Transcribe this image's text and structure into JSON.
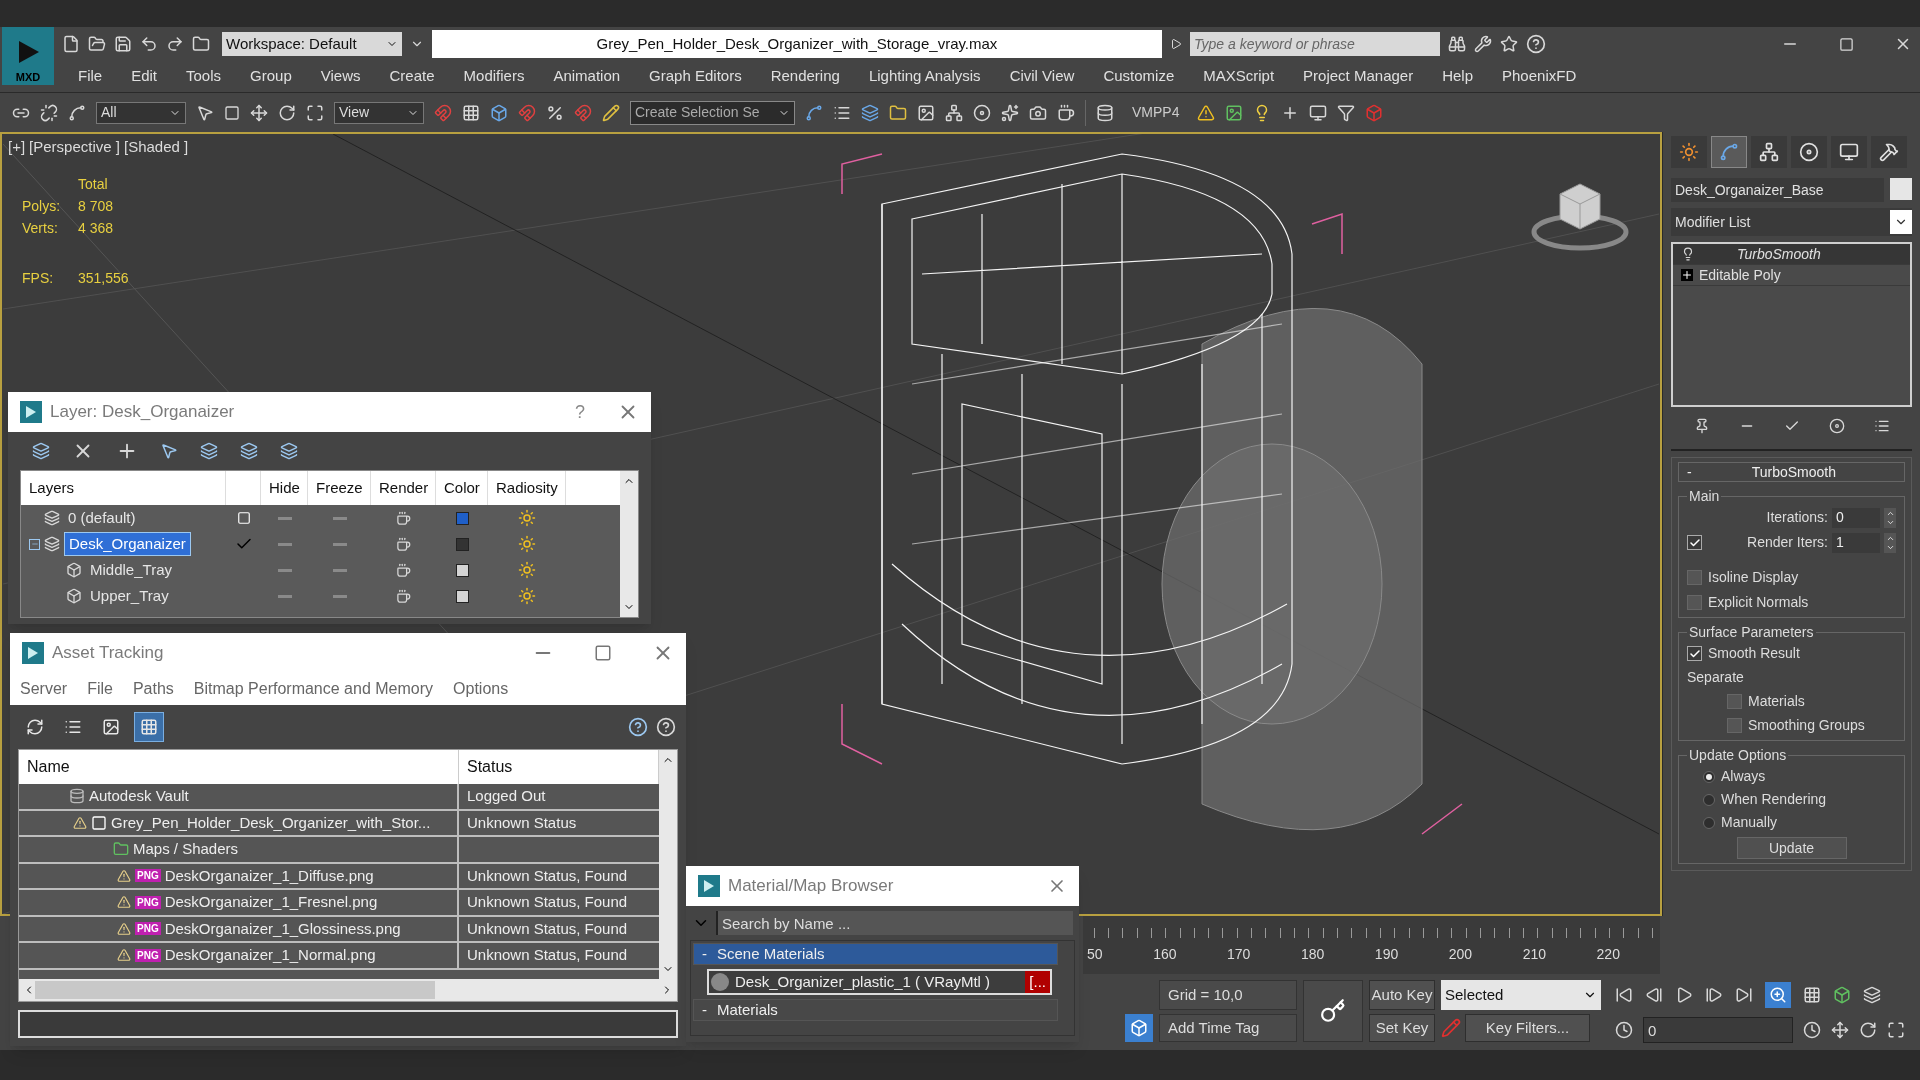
{
  "app_badge": "MXD",
  "title_bar": {
    "workspace": "Workspace: Default",
    "title": "Grey_Pen_Holder_Desk_Organizer_with_Storage_vray.max",
    "search": {
      "placeholder": "Type a keyword or phrase"
    }
  },
  "menu": [
    "File",
    "Edit",
    "Tools",
    "Group",
    "Views",
    "Create",
    "Modifiers",
    "Animation",
    "Graph Editors",
    "Rendering",
    "Lighting Analysis",
    "Civil View",
    "Customize",
    "MAXScript",
    "Project Manager",
    "Help",
    "PhoenixFD"
  ],
  "toolbar": {
    "selection_filter": "All",
    "reference_coordinate": "View",
    "named_selection": {
      "placeholder": "Create Selection Se"
    },
    "plugin": "VMPP4"
  },
  "viewport": {
    "labels": [
      "[+]",
      "[Perspective ]",
      "[Shaded ]"
    ],
    "stats_header": "Total",
    "stats": [
      {
        "label": "Polys:",
        "value": "8 708"
      },
      {
        "label": "Verts:",
        "value": "4 368"
      }
    ],
    "fps": {
      "label": "FPS:",
      "value": "351,556"
    }
  },
  "layer_dialog": {
    "title": "Layer: Desk_Organaizer",
    "help": "?",
    "columns": [
      "Layers",
      "Hide",
      "Freeze",
      "Render",
      "Color",
      "Radiosity"
    ],
    "rows": [
      {
        "kind": "layer",
        "name": "0 (default)",
        "current": false,
        "selected": false,
        "color": "#1f5fc8"
      },
      {
        "kind": "layer",
        "name": "Desk_Organaizer",
        "current": true,
        "selected": true,
        "expanded": true,
        "color": "#333333",
        "children": [
          {
            "kind": "object",
            "name": "Middle_Tray",
            "selected": false,
            "color": "#d4d4d4"
          },
          {
            "kind": "object",
            "name": "Upper_Tray",
            "selected": false,
            "color": "#d4d4d4"
          }
        ]
      }
    ]
  },
  "asset_tracking": {
    "title": "Asset Tracking",
    "menu": [
      "Server",
      "File",
      "Paths",
      "Bitmap Performance and Memory",
      "Options"
    ],
    "views": [
      {
        "selected": false
      },
      {
        "selected": false
      },
      {
        "selected": false
      },
      {
        "selected": true
      }
    ],
    "columns": [
      "Name",
      "Status"
    ],
    "rows": [
      {
        "kind": "vault",
        "warning": false,
        "name": "Autodesk Vault",
        "status": "Logged Out",
        "children": [
          {
            "kind": "scene",
            "warning": true,
            "name": "Grey_Pen_Holder_Desk_Organizer_with_Stor...",
            "status": "Unknown Status",
            "children": [
              {
                "kind": "folder",
                "warning": false,
                "name": "Maps / Shaders",
                "children": [
                  {
                    "kind": "bitmap",
                    "warning": true,
                    "badge": "PNG",
                    "name": "DeskOrganaizer_1_Diffuse.png",
                    "status": "Unknown Status, Found"
                  },
                  {
                    "kind": "bitmap",
                    "warning": true,
                    "badge": "PNG",
                    "name": "DeskOrganaizer_1_Fresnel.png",
                    "status": "Unknown Status, Found"
                  },
                  {
                    "kind": "bitmap",
                    "warning": true,
                    "badge": "PNG",
                    "name": "DeskOrganaizer_1_Glossiness.png",
                    "status": "Unknown Status, Found"
                  },
                  {
                    "kind": "bitmap",
                    "warning": true,
                    "badge": "PNG",
                    "name": "DeskOrganaizer_1_Normal.png",
                    "status": "Unknown Status, Found"
                  }
                ]
              }
            ]
          }
        ]
      }
    ]
  },
  "material_browser": {
    "title": "Material/Map Browser",
    "search": {
      "placeholder": "Search by Name ..."
    },
    "groups": [
      {
        "toggle": "-",
        "label": "Scene Materials",
        "selected": true,
        "items": [
          {
            "label": "Desk_Organizer_plastic_1 ( VRayMtl )",
            "tag": "[..."
          }
        ]
      },
      {
        "toggle": "-",
        "label": "Materials",
        "selected": false
      }
    ]
  },
  "command_panel": {
    "tabs": [
      {
        "selected": false
      },
      {
        "selected": true
      },
      {
        "selected": false
      },
      {
        "selected": false
      },
      {
        "selected": false
      },
      {
        "selected": false
      }
    ],
    "object_name": "Desk_Organaizer_Base",
    "modifier_list": "Modifier List",
    "stack": [
      {
        "kind": "modifier",
        "label": "TurboSmooth",
        "selected": true
      },
      {
        "kind": "base",
        "label": "Editable Poly",
        "selected": false
      }
    ],
    "rollout": {
      "toggle": "-",
      "title": "TurboSmooth",
      "main": {
        "title": "Main",
        "spinners": [
          {
            "kind": "spinner",
            "label": "Iterations:",
            "value": "0"
          },
          {
            "kind": "check_spinner",
            "label": "Render Iters:",
            "value": "1",
            "checked": true
          }
        ],
        "checks": [
          {
            "label": "Isoline Display",
            "checked": false
          },
          {
            "label": "Explicit Normals",
            "checked": false
          }
        ]
      },
      "surface": {
        "title": "Surface Parameters",
        "smooth": {
          "label": "Smooth Result",
          "checked": true
        },
        "separate": "Separate",
        "checks": [
          {
            "label": "Materials",
            "checked": false
          },
          {
            "label": "Smoothing Groups",
            "checked": false
          }
        ]
      },
      "update": {
        "title": "Update Options",
        "radios": [
          {
            "label": "Always",
            "selected": true
          },
          {
            "label": "When Rendering",
            "selected": false
          },
          {
            "label": "Manually",
            "selected": false
          }
        ],
        "button": "Update"
      }
    }
  },
  "timeline": {
    "ticks": [
      "50",
      "160",
      "170",
      "180",
      "190",
      "200",
      "210",
      "220"
    ]
  },
  "controls": {
    "time_tag": "Add Time Tag",
    "grid": "Grid = 10,0",
    "auto_key": "Auto Key",
    "set_key": "Set Key",
    "key_mode": "Selected",
    "key_filters": "Key Filters...",
    "frame": "0"
  }
}
